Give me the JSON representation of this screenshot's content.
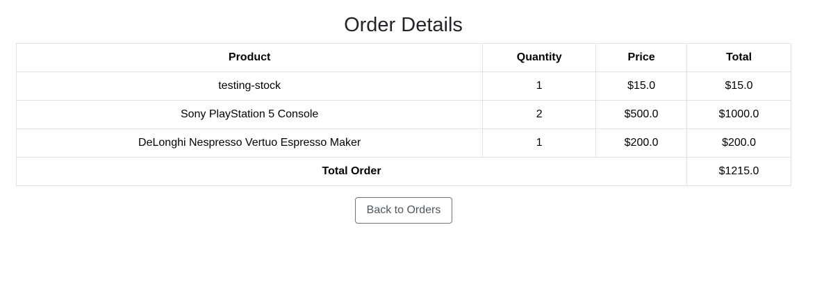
{
  "page": {
    "title": "Order Details"
  },
  "table": {
    "headers": [
      "Product",
      "Quantity",
      "Price",
      "Total"
    ],
    "rows": [
      {
        "product": "testing-stock",
        "quantity": "1",
        "price": "$15.0",
        "total": "$15.0"
      },
      {
        "product": "Sony PlayStation 5 Console",
        "quantity": "2",
        "price": "$500.0",
        "total": "$1000.0"
      },
      {
        "product": "DeLonghi Nespresso Vertuo Espresso Maker",
        "quantity": "1",
        "price": "$200.0",
        "total": "$200.0"
      }
    ],
    "footer": {
      "label": "Total Order",
      "value": "$1215.0"
    }
  },
  "actions": {
    "back_label": "Back to Orders"
  },
  "colors": {
    "border": "#dee2e6",
    "button_border": "#6c757d",
    "title": "#212529"
  }
}
